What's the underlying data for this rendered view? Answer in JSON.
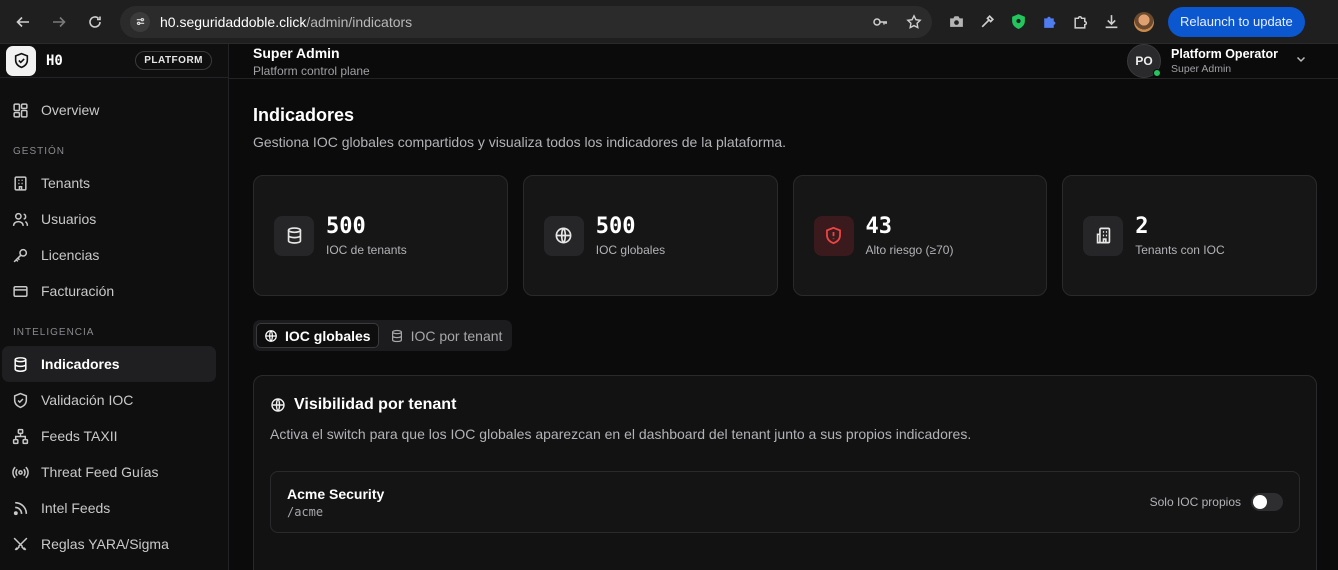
{
  "browser": {
    "url_host": "h0.seguridaddoble.click",
    "url_path": "/admin/indicators",
    "relaunch_label": "Relaunch to update"
  },
  "brand": {
    "name": "H0",
    "badge": "PLATFORM"
  },
  "sidebar": {
    "overview": "Overview",
    "section_gestion": "GESTIÓN",
    "gestion_items": [
      "Tenants",
      "Usuarios",
      "Licencias",
      "Facturación"
    ],
    "section_inteligencia": "INTELIGENCIA",
    "inteligencia_items": [
      "Indicadores",
      "Validación IOC",
      "Feeds TAXII",
      "Threat Feed Guías",
      "Intel Feeds",
      "Reglas YARA/Sigma"
    ]
  },
  "topbar": {
    "title": "Super Admin",
    "subtitle": "Platform control plane",
    "user_initials": "PO",
    "user_name": "Platform Operator",
    "user_role": "Super Admin"
  },
  "page": {
    "title": "Indicadores",
    "subtitle": "Gestiona IOC globales compartidos y visualiza todos los indicadores de la plataforma."
  },
  "stats": [
    {
      "value": "500",
      "label": "IOC de tenants",
      "icon": "database-icon"
    },
    {
      "value": "500",
      "label": "IOC globales",
      "icon": "globe-icon"
    },
    {
      "value": "43",
      "label": "Alto riesgo (≥70)",
      "icon": "shield-alert-icon",
      "color": "#ef4444"
    },
    {
      "value": "2",
      "label": "Tenants con IOC",
      "icon": "building-icon"
    }
  ],
  "tabs": {
    "global": "IOC globales",
    "per_tenant": "IOC por tenant"
  },
  "panel": {
    "title": "Visibilidad por tenant",
    "subtitle": "Activa el switch para que los IOC globales aparezcan en el dashboard del tenant junto a sus propios indicadores.",
    "tenant": {
      "name": "Acme Security",
      "slug": "/acme",
      "toggle_label": "Solo IOC propios",
      "toggle_on": false
    }
  }
}
